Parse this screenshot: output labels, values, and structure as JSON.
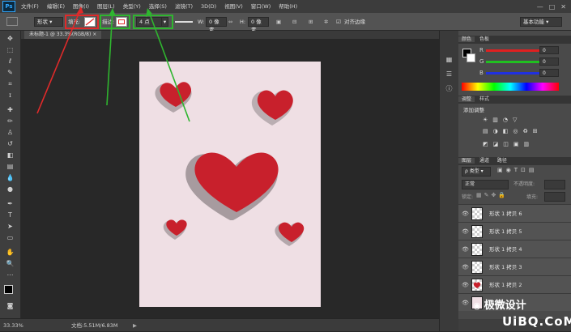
{
  "app": {
    "logo": "Ps"
  },
  "menu": [
    "文件(F)",
    "编辑(E)",
    "图像(I)",
    "图层(L)",
    "类型(Y)",
    "选择(S)",
    "滤镜(T)",
    "3D(D)",
    "视图(V)",
    "窗口(W)",
    "帮助(H)"
  ],
  "window_controls": {
    "minimize": "—",
    "restore": "□",
    "close": "✕"
  },
  "options": {
    "mode": "形状",
    "fill_label": "填充:",
    "stroke_label": "描边:",
    "stroke_width": "4 点",
    "w_label": "W:",
    "w_value": "0 像素",
    "h_label": "H:",
    "h_value": "0 像素",
    "align_edges": "对齐边缘",
    "workspace": "基本功能"
  },
  "document": {
    "tab_title": "未标题-1 @ 33.3%(RGB/8)",
    "close": "×",
    "zoom": "33.33%",
    "doc_info": "文档:5.51M/6.83M"
  },
  "color_panel": {
    "tabs": [
      "颜色",
      "色板"
    ],
    "channels": [
      {
        "label": "R",
        "value": "0"
      },
      {
        "label": "G",
        "value": "0"
      },
      {
        "label": "B",
        "value": "0"
      }
    ]
  },
  "adjust_panel": {
    "tabs": [
      "调整",
      "样式"
    ],
    "title": "添加调整"
  },
  "layers_panel": {
    "tabs": [
      "图层",
      "通道",
      "路径"
    ],
    "filter": "类型",
    "blend": "正常",
    "opacity_label": "不透明度:",
    "lock_label": "锁定:",
    "fill_label": "填充:",
    "layers": [
      {
        "name": "形状 1 拷贝 6",
        "has_heart": false
      },
      {
        "name": "形状 1 拷贝 5",
        "has_heart": false
      },
      {
        "name": "形状 1 拷贝 4",
        "has_heart": false
      },
      {
        "name": "形状 1 拷贝 3",
        "has_heart": false
      },
      {
        "name": "形状 1 拷贝 2",
        "has_heart": true
      },
      {
        "name": "图层",
        "has_heart": false
      }
    ]
  },
  "watermark": {
    "line1": "极微设计",
    "line2": "UiBQ.CoM"
  },
  "colors": {
    "accent_red": "#e02a2a",
    "accent_green": "#2fb52f",
    "heart": "#c8202c",
    "doc_bg": "#efdfe4"
  }
}
